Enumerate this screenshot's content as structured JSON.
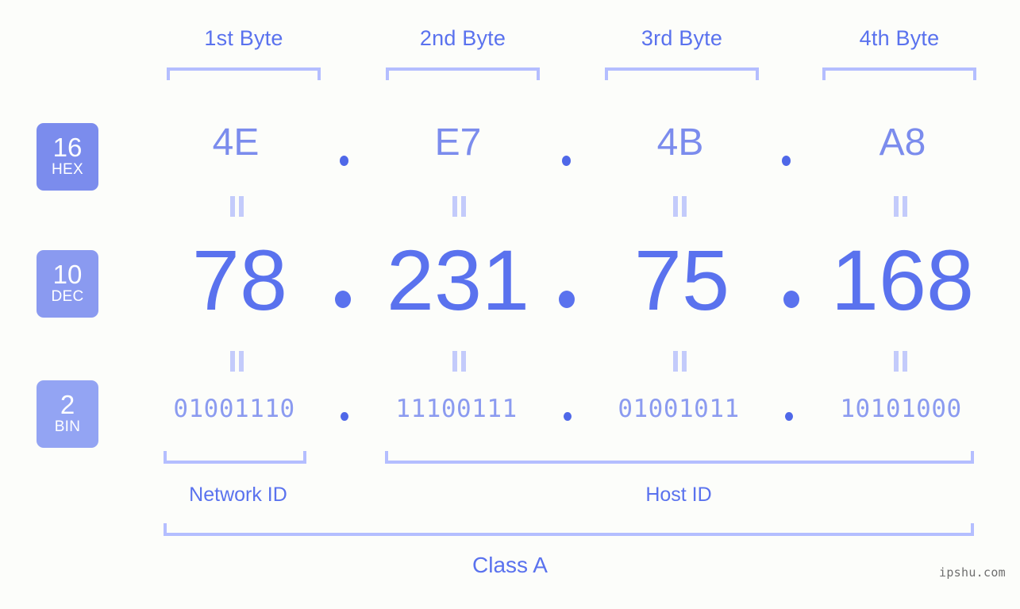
{
  "page": {
    "background_color": "#fcfdfa",
    "accent_strong": "#5a72ee",
    "accent_mid": "#7b8ced",
    "accent_light": "#8b9bf0",
    "bracket_color": "#b4beff",
    "watermark": "ipshu.com"
  },
  "byte_headers": [
    {
      "label": "1st Byte"
    },
    {
      "label": "2nd Byte"
    },
    {
      "label": "3rd Byte"
    },
    {
      "label": "4th Byte"
    }
  ],
  "bases": [
    {
      "number": "16",
      "abbr": "HEX",
      "color": "#7b8ced"
    },
    {
      "number": "10",
      "abbr": "DEC",
      "color": "#8a9af0"
    },
    {
      "number": "2",
      "abbr": "BIN",
      "color": "#93a4f3"
    }
  ],
  "rows": {
    "hex": {
      "octets": [
        "4E",
        "E7",
        "4B",
        "A8"
      ],
      "separator": "."
    },
    "dec": {
      "octets": [
        "78",
        "231",
        "75",
        "168"
      ],
      "separator": "."
    },
    "bin": {
      "octets": [
        "01001110",
        "11100111",
        "01001011",
        "10101000"
      ],
      "separator": "."
    }
  },
  "segments": {
    "network_id": "Network ID",
    "host_id": "Host ID"
  },
  "class": {
    "label": "Class A"
  }
}
